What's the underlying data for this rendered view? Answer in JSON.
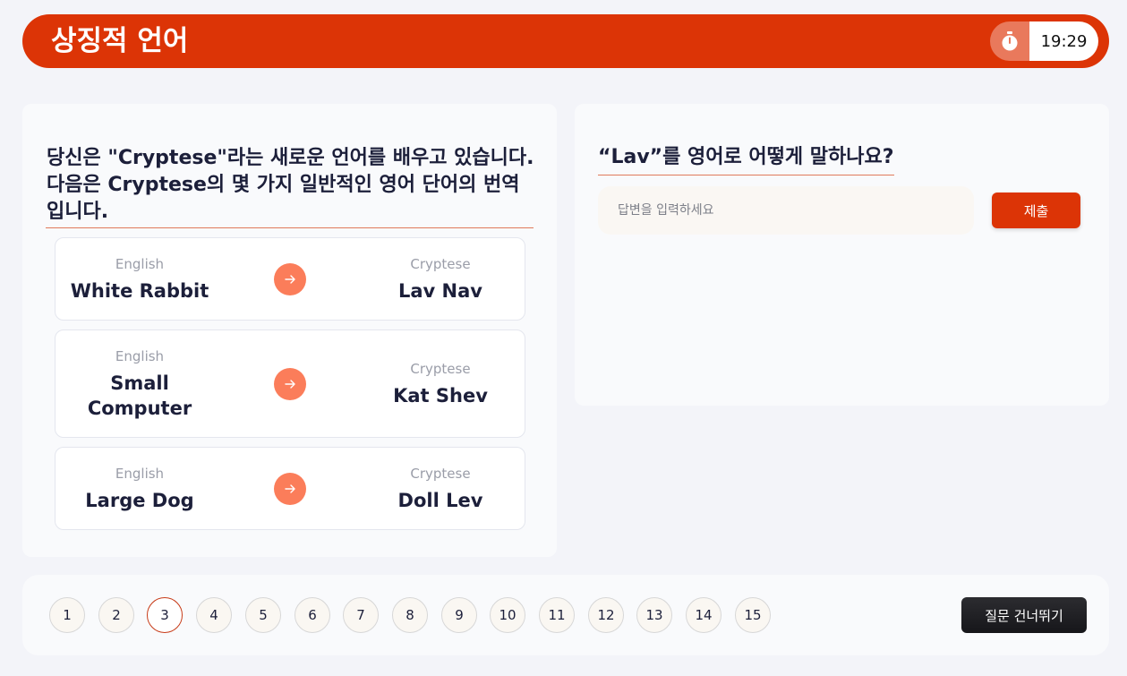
{
  "header": {
    "title": "상징적 언어",
    "timer": "19:29"
  },
  "intro": {
    "text": "당신은 \"Cryptese\"라는 새로운 언어를 배우고 있습니다. 다음은 Cryptese의 몇 가지 일반적인 영어 단어의 번역입니다."
  },
  "translations": [
    {
      "en_label": "English",
      "en_word": "White Rabbit",
      "cr_label": "Cryptese",
      "cr_word": "Lav Nav"
    },
    {
      "en_label": "English",
      "en_word": "Small Computer",
      "cr_label": "Cryptese",
      "cr_word": "Kat Shev"
    },
    {
      "en_label": "English",
      "en_word": "Large Dog",
      "cr_label": "Cryptese",
      "cr_word": "Doll Lev"
    }
  ],
  "question": {
    "text": "“Lav”를 영어로 어떻게 말하나요?",
    "input_placeholder": "답변을 입력하세요",
    "input_value": "",
    "submit_label": "제출"
  },
  "pagination": {
    "pages": [
      "1",
      "2",
      "3",
      "4",
      "5",
      "6",
      "7",
      "8",
      "9",
      "10",
      "11",
      "12",
      "13",
      "14",
      "15"
    ],
    "current": "3"
  },
  "skip_label": "질문 건너뛰기",
  "colors": {
    "accent": "#dc3406",
    "arrow": "#fb7d5a",
    "underline": "#e07a5b"
  },
  "icons": {
    "timer": "stopwatch-icon",
    "arrow": "arrow-right-icon"
  }
}
